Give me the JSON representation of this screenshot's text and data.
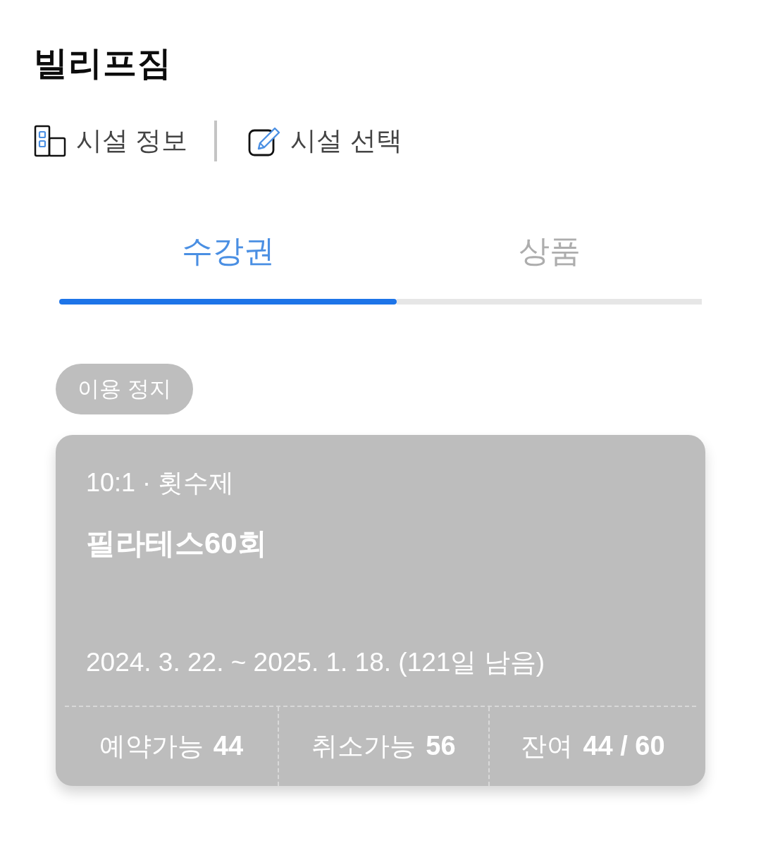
{
  "header": {
    "title": "빌리프짐"
  },
  "links": [
    {
      "label": "시설 정보",
      "kind": "info"
    },
    {
      "label": "시설 선택",
      "kind": "edit"
    }
  ],
  "tabs": [
    {
      "label": "수강권",
      "selected": true
    },
    {
      "label": "상품",
      "selected": false
    }
  ],
  "pass": {
    "status": "이용 정지",
    "meta": "10:1 · 횟수제",
    "name": "필라테스60회",
    "period": "2024. 3. 22. ~ 2025. 1. 18. (121일 남음)",
    "stats": [
      {
        "label": "예약가능",
        "value": "44"
      },
      {
        "label": "취소가능",
        "value": "56"
      },
      {
        "label": "잔여",
        "value": "44 / 60"
      }
    ]
  }
}
